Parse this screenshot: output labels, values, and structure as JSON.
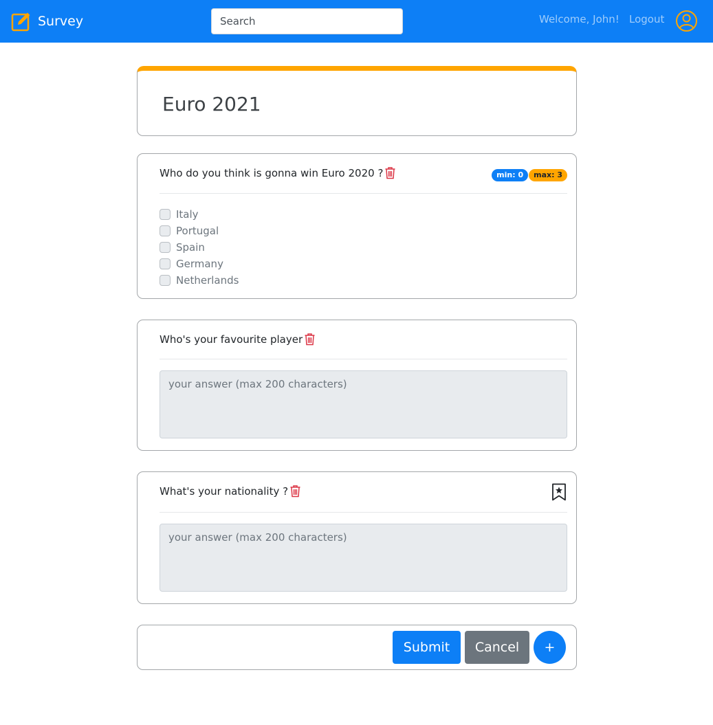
{
  "navbar": {
    "brand": "Survey",
    "brand_icon": "edit-square-icon",
    "search_placeholder": "Search",
    "welcome": "Welcome, John!",
    "logout": "Logout",
    "user_icon": "user-circle-icon"
  },
  "survey": {
    "title": "Euro 2021",
    "accent_color": "#ffa500"
  },
  "questions": [
    {
      "text": "Who do you think is gonna win Euro 2020 ?",
      "min_badge": "min: 0",
      "max_badge": "max: 3",
      "options": [
        "Italy",
        "Portugal",
        "Spain",
        "Germany",
        "Netherlands"
      ]
    },
    {
      "text": "Who's your favourite player",
      "placeholder": "your answer (max 200 characters)"
    },
    {
      "text": "What's your nationality ?",
      "placeholder": "your answer (max 200 characters)",
      "icon": "bookmark-star-icon"
    }
  ],
  "footer": {
    "submit": "Submit",
    "cancel": "Cancel",
    "add": "+"
  },
  "colors": {
    "primary": "#0d7ff6",
    "secondary": "#6c757d",
    "danger": "#dc3545",
    "warning": "#ffa500"
  }
}
